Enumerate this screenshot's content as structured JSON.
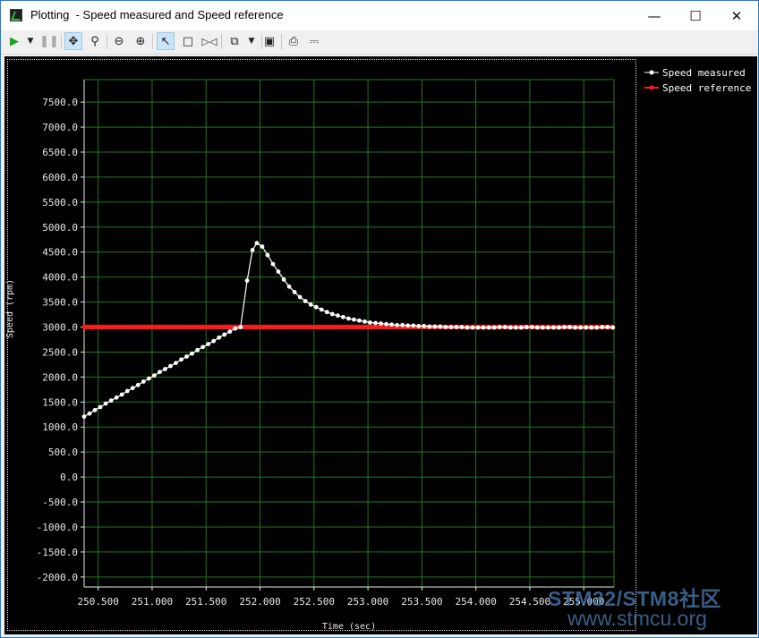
{
  "window": {
    "title": "Plotting  - Speed measured and Speed reference",
    "minimize_icon": "minimize-icon",
    "maximize_icon": "maximize-icon",
    "close_icon": "close-icon"
  },
  "toolbar": {
    "icons": [
      "play-icon",
      "dropdown-icon",
      "pause-icon",
      "pan-icon",
      "zoom-fit-icon",
      "zoom-out-icon",
      "zoom-in-icon",
      "select-cursor-icon",
      "rect-select-icon",
      "marker-icon",
      "copy-icon",
      "dropdown-icon",
      "save-icon",
      "print-icon",
      "print-preview-icon"
    ]
  },
  "watermark": {
    "line1": "STM32/STM8社区",
    "line2": "www.stmcu.org"
  },
  "colors": {
    "background": "#000000",
    "grid": "#1f7a1f",
    "measured": "#ffffff",
    "reference": "#ff1a1a"
  },
  "chart_data": {
    "type": "line",
    "title": "",
    "xlabel": "Time (sec)",
    "ylabel": "Speed (rpm)",
    "xlim": [
      250.37,
      255.28
    ],
    "ylim": [
      -2200,
      7950
    ],
    "x_ticks": [
      250.5,
      251.0,
      251.5,
      252.0,
      252.5,
      253.0,
      253.5,
      254.0,
      254.5,
      255.0
    ],
    "x_tick_labels": [
      "250.500",
      "251.000",
      "251.500",
      "252.000",
      "252.500",
      "253.000",
      "253.500",
      "254.000",
      "254.500",
      "255.000"
    ],
    "y_ticks": [
      7500,
      7000,
      6500,
      6000,
      5500,
      5000,
      4500,
      4000,
      3500,
      3000,
      2500,
      2000,
      1500,
      1000,
      500,
      0,
      -500,
      -1000,
      -1500,
      -2000
    ],
    "y_tick_labels": [
      "7500.0",
      "7000.0",
      "6500.0",
      "6000.0",
      "5500.0",
      "5000.0",
      "4500.0",
      "4000.0",
      "3500.0",
      "3000.0",
      "2500.0",
      "2000.0",
      "1500.0",
      "1000.0",
      "500.0",
      "0.0",
      "-500.0",
      "-1000.0",
      "-1500.0",
      "-2000.0"
    ],
    "grid": true,
    "legend_position": "top-right outside",
    "series": [
      {
        "name": "Speed measured",
        "color": "#ffffff",
        "points": [
          [
            250.37,
            1210
          ],
          [
            250.42,
            1270
          ],
          [
            250.47,
            1340
          ],
          [
            250.52,
            1400
          ],
          [
            250.57,
            1470
          ],
          [
            250.62,
            1530
          ],
          [
            250.67,
            1590
          ],
          [
            250.72,
            1650
          ],
          [
            250.77,
            1720
          ],
          [
            250.82,
            1780
          ],
          [
            250.87,
            1840
          ],
          [
            250.92,
            1910
          ],
          [
            250.97,
            1970
          ],
          [
            251.02,
            2030
          ],
          [
            251.07,
            2100
          ],
          [
            251.12,
            2160
          ],
          [
            251.17,
            2220
          ],
          [
            251.22,
            2280
          ],
          [
            251.27,
            2350
          ],
          [
            251.32,
            2410
          ],
          [
            251.37,
            2470
          ],
          [
            251.42,
            2540
          ],
          [
            251.47,
            2600
          ],
          [
            251.52,
            2660
          ],
          [
            251.57,
            2720
          ],
          [
            251.62,
            2790
          ],
          [
            251.67,
            2850
          ],
          [
            251.72,
            2910
          ],
          [
            251.77,
            2970
          ],
          [
            251.82,
            3000
          ],
          [
            251.88,
            3930
          ],
          [
            251.93,
            4540
          ],
          [
            251.97,
            4680
          ],
          [
            252.02,
            4610
          ],
          [
            252.07,
            4440
          ],
          [
            252.12,
            4260
          ],
          [
            252.17,
            4110
          ],
          [
            252.22,
            3950
          ],
          [
            252.27,
            3810
          ],
          [
            252.32,
            3700
          ],
          [
            252.37,
            3600
          ],
          [
            252.42,
            3520
          ],
          [
            252.47,
            3450
          ],
          [
            252.52,
            3400
          ],
          [
            252.57,
            3350
          ],
          [
            252.62,
            3300
          ],
          [
            252.67,
            3260
          ],
          [
            252.72,
            3230
          ],
          [
            252.77,
            3200
          ],
          [
            252.82,
            3170
          ],
          [
            252.87,
            3150
          ],
          [
            252.92,
            3130
          ],
          [
            252.97,
            3110
          ],
          [
            253.02,
            3090
          ],
          [
            253.07,
            3080
          ],
          [
            253.12,
            3070
          ],
          [
            253.17,
            3060
          ],
          [
            253.22,
            3050
          ],
          [
            253.27,
            3040
          ],
          [
            253.32,
            3040
          ],
          [
            253.37,
            3030
          ],
          [
            253.42,
            3030
          ],
          [
            253.47,
            3020
          ],
          [
            253.52,
            3020
          ],
          [
            253.57,
            3010
          ],
          [
            253.62,
            3010
          ],
          [
            253.67,
            3010
          ],
          [
            253.72,
            3000
          ],
          [
            253.77,
            3000
          ],
          [
            253.82,
            3000
          ],
          [
            253.87,
            3000
          ],
          [
            253.92,
            2990
          ],
          [
            253.97,
            2990
          ],
          [
            254.02,
            2990
          ],
          [
            254.07,
            2990
          ],
          [
            254.12,
            2990
          ],
          [
            254.17,
            2990
          ],
          [
            254.22,
            3000
          ],
          [
            254.27,
            3000
          ],
          [
            254.32,
            2990
          ],
          [
            254.37,
            2990
          ],
          [
            254.42,
            2990
          ],
          [
            254.47,
            3000
          ],
          [
            254.52,
            3000
          ],
          [
            254.57,
            2990
          ],
          [
            254.62,
            2990
          ],
          [
            254.67,
            2990
          ],
          [
            254.72,
            2990
          ],
          [
            254.77,
            2990
          ],
          [
            254.82,
            3000
          ],
          [
            254.87,
            3000
          ],
          [
            254.92,
            2990
          ],
          [
            254.97,
            2990
          ],
          [
            255.02,
            2990
          ],
          [
            255.07,
            2990
          ],
          [
            255.12,
            2990
          ],
          [
            255.17,
            3000
          ],
          [
            255.22,
            3000
          ],
          [
            255.27,
            2990
          ]
        ]
      },
      {
        "name": "Speed reference",
        "color": "#ff1a1a",
        "constant_value": 3000,
        "x_start": 250.37,
        "x_end": 255.28,
        "x_step": 0.02
      }
    ]
  }
}
